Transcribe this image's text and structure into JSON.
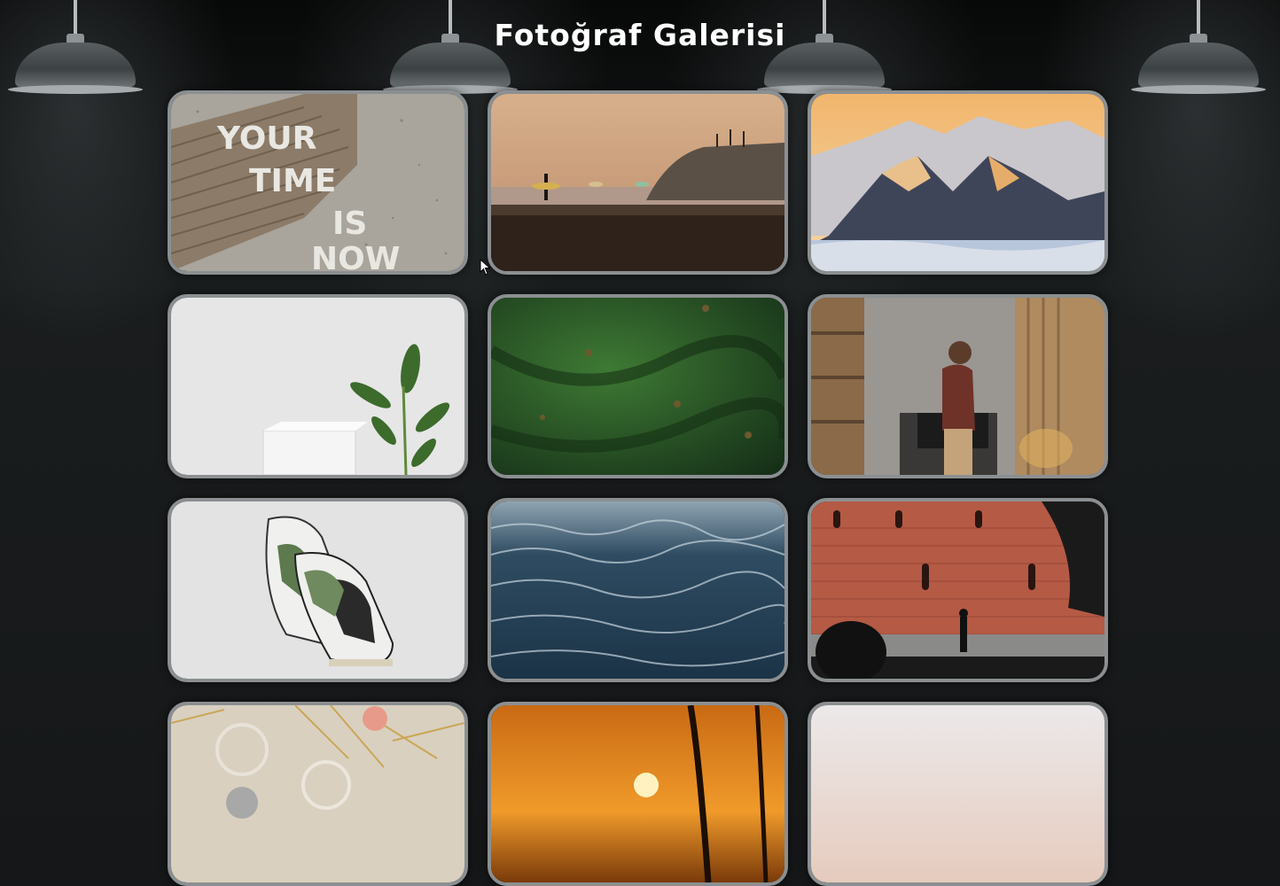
{
  "page": {
    "title": "Fotoğraf Galerisi"
  },
  "gallery": {
    "photos": [
      {
        "icon": "letterboard-photo",
        "text_line1": "YOUR",
        "text_line2": "TIME",
        "text_line3": "IS",
        "text_line4": "NOW"
      },
      {
        "icon": "beach-surfers-photo"
      },
      {
        "icon": "snowy-mountains-photo"
      },
      {
        "icon": "plant-pedestal-photo"
      },
      {
        "icon": "cactus-closeup-photo"
      },
      {
        "icon": "man-in-room-photo"
      },
      {
        "icon": "sneakers-photo"
      },
      {
        "icon": "ocean-waves-photo"
      },
      {
        "icon": "brick-wall-silhouette-photo"
      },
      {
        "icon": "glasses-tinsel-photo"
      },
      {
        "icon": "sunset-palm-photo"
      },
      {
        "icon": "pale-sky-photo"
      }
    ]
  },
  "colors": {
    "background": "#151718",
    "frame": "#8b8f91",
    "title": "#ffffff"
  }
}
